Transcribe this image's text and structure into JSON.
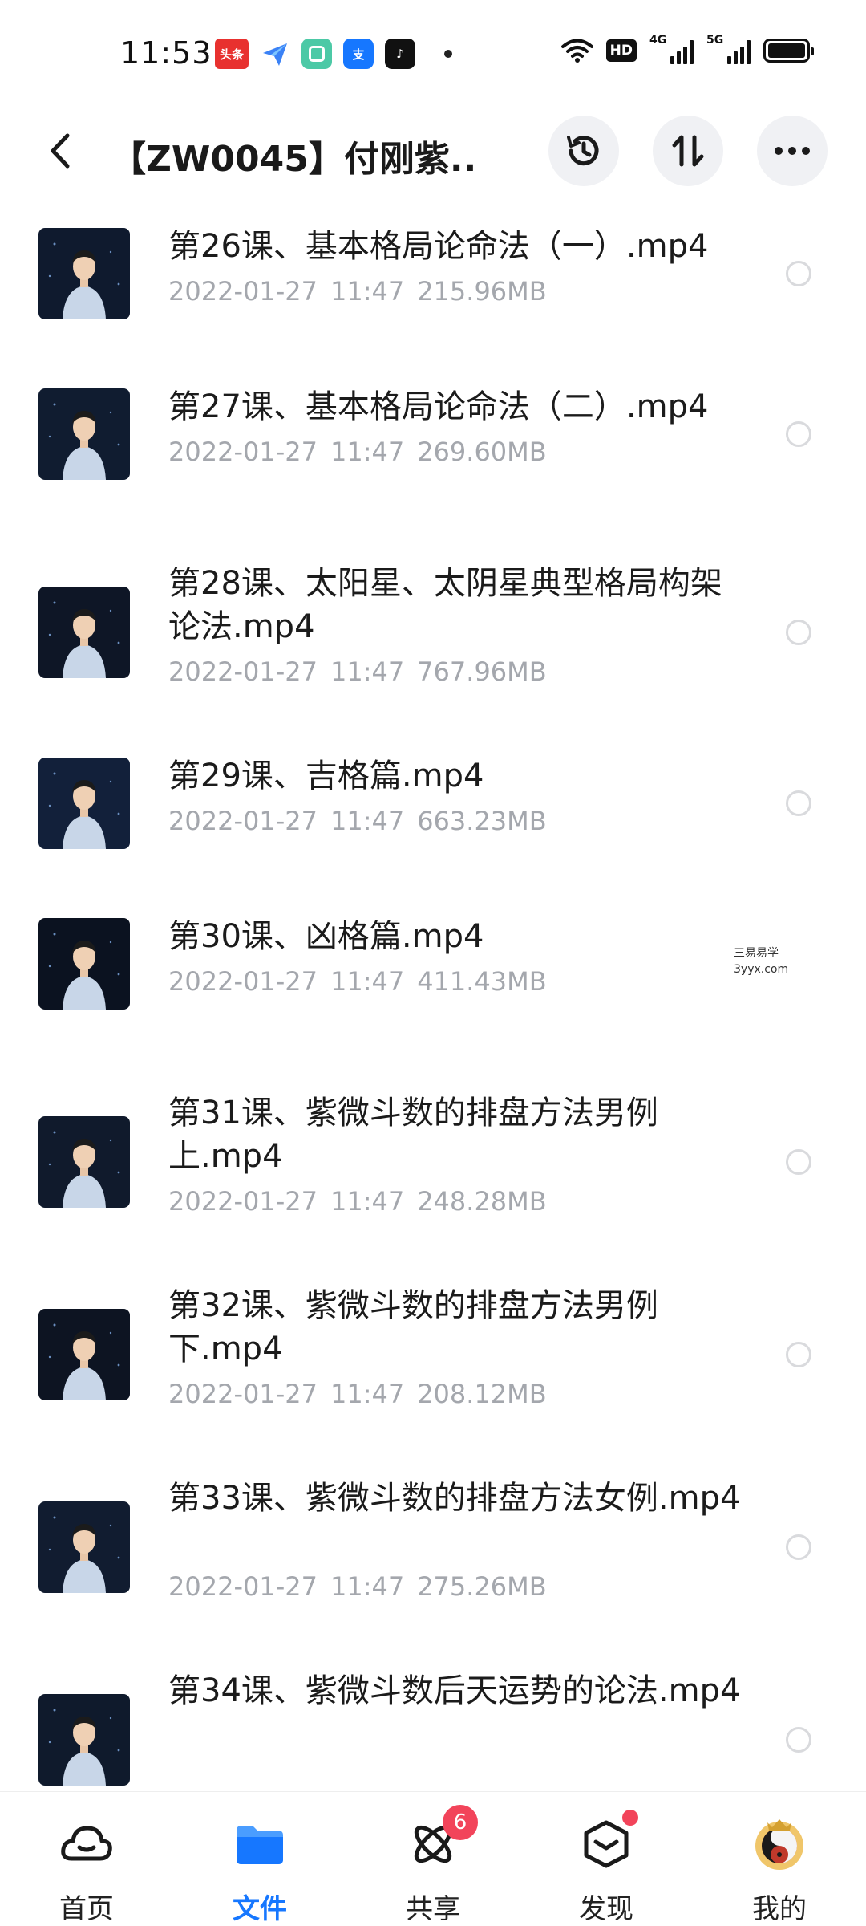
{
  "status_bar": {
    "time": "11:53",
    "apps": [
      {
        "name": "toutiao-app-icon",
        "label": "头条",
        "color": "#e8312f"
      },
      {
        "name": "feishu-app-icon",
        "label": "",
        "color": "#3b82f6"
      },
      {
        "name": "green-app-icon",
        "label": "",
        "color": "#4cc9a6"
      },
      {
        "name": "alipay-app-icon",
        "label": "支",
        "color": "#1677ff"
      },
      {
        "name": "douyin-app-icon",
        "label": "♪",
        "color": "#111111"
      }
    ],
    "hd_label": "HD",
    "net1": "4G",
    "net2": "5G"
  },
  "header": {
    "title": "【ZW0045】付刚紫..."
  },
  "files": [
    {
      "name": "第26课、基本格局论命法（一）.mp4",
      "date": "2022-01-27",
      "time": "11:47",
      "size": "215.96MB"
    },
    {
      "name": "第27课、基本格局论命法（二）.mp4",
      "date": "2022-01-27",
      "time": "11:47",
      "size": "269.60MB"
    },
    {
      "name": "第28课、太阳星、太阴星典型格局构架论法.mp4",
      "date": "2022-01-27",
      "time": "11:47",
      "size": "767.96MB"
    },
    {
      "name": "第29课、吉格篇.mp4",
      "date": "2022-01-27",
      "time": "11:47",
      "size": "663.23MB"
    },
    {
      "name": "第30课、凶格篇.mp4",
      "date": "2022-01-27",
      "time": "11:47",
      "size": "411.43MB"
    },
    {
      "name": "第31课、紫微斗数的排盘方法男例上.mp4",
      "date": "2022-01-27",
      "time": "11:47",
      "size": "248.28MB"
    },
    {
      "name": "第32课、紫微斗数的排盘方法男例下.mp4",
      "date": "2022-01-27",
      "time": "11:47",
      "size": "208.12MB"
    },
    {
      "name": "第33课、紫微斗数的排盘方法女例.mp4",
      "date": "2022-01-27",
      "time": "11:47",
      "size": "275.26MB"
    },
    {
      "name": "第34课、紫微斗数后天运势的论法.mp4",
      "date": "",
      "time": "",
      "size": ""
    }
  ],
  "watermark": {
    "line1": "三易易学",
    "line2": "3yyx.com"
  },
  "nav": {
    "items": [
      {
        "label": "首页",
        "icon": "cloud-icon"
      },
      {
        "label": "文件",
        "icon": "folder-icon"
      },
      {
        "label": "共享",
        "icon": "atom-icon"
      },
      {
        "label": "发现",
        "icon": "cube-icon"
      },
      {
        "label": "我的",
        "icon": "avatar"
      }
    ],
    "share_badge": "6"
  },
  "colors": {
    "accent": "#1677ff",
    "badge": "#f2445a",
    "meta": "#a4a7ad"
  }
}
